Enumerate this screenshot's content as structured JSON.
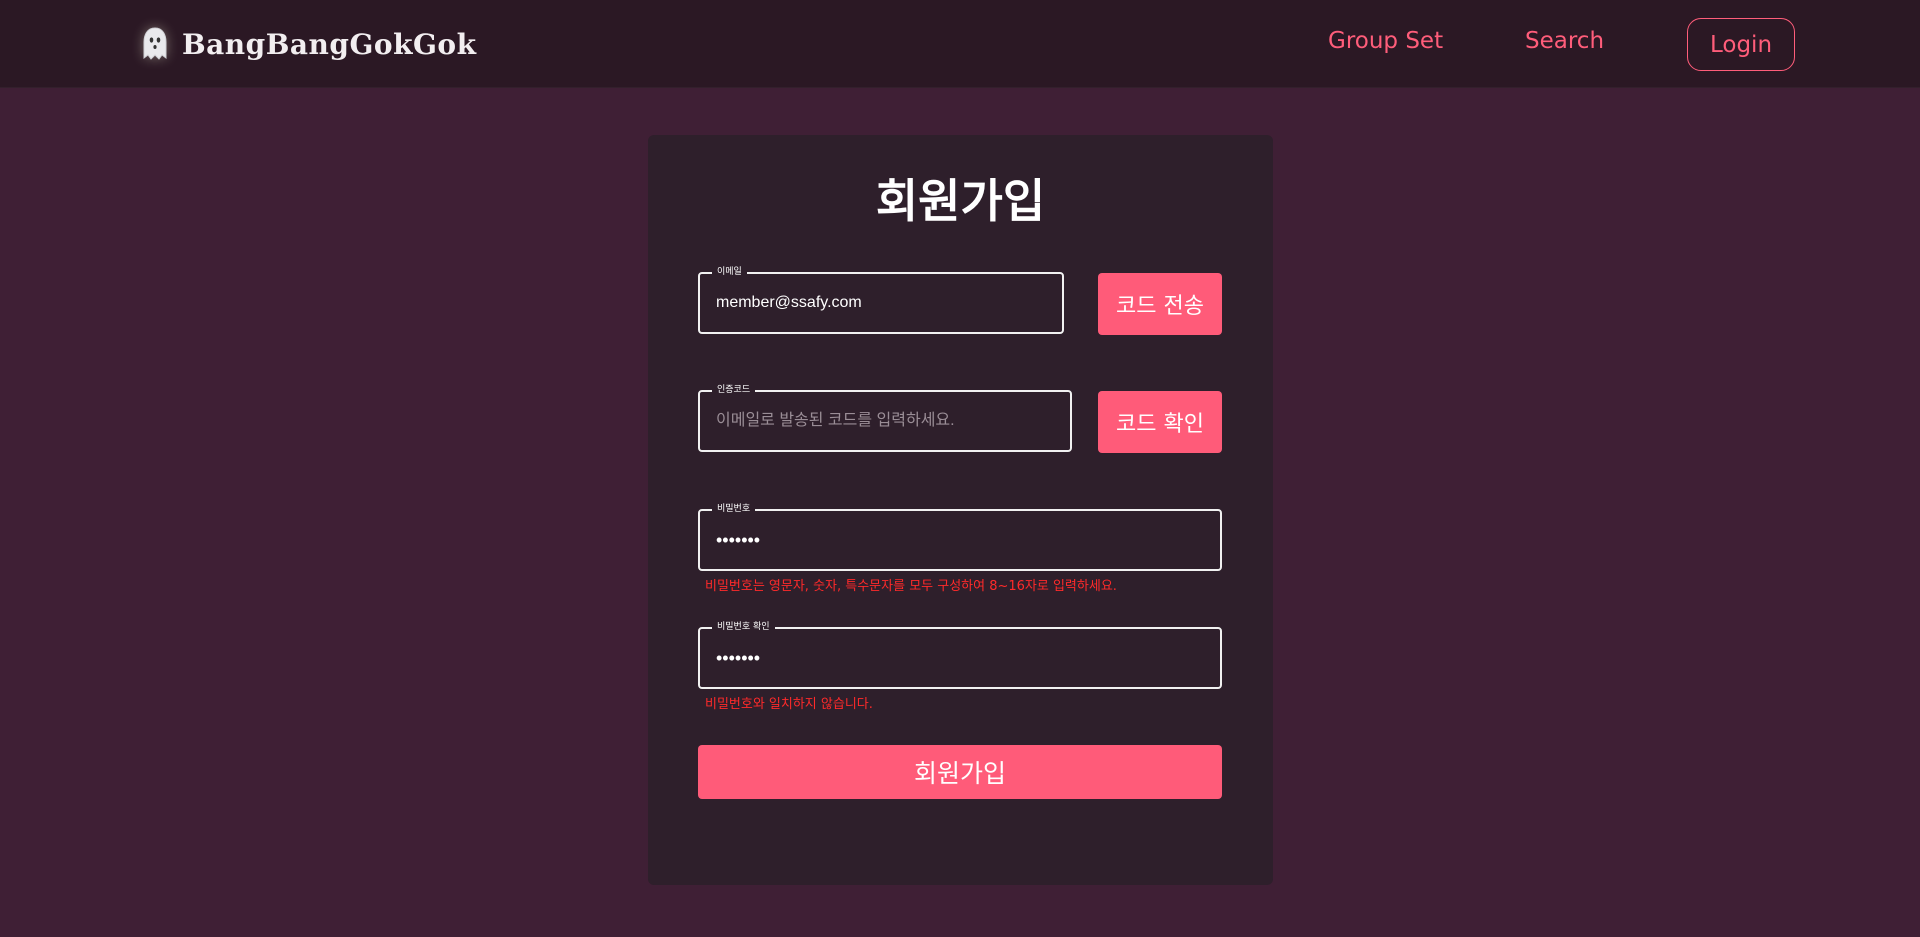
{
  "header": {
    "brand": "BangBangGokGok",
    "nav": [
      {
        "label": "Group Set"
      },
      {
        "label": "Search"
      }
    ],
    "login_label": "Login"
  },
  "signup": {
    "title": "회원가입",
    "email": {
      "label": "이메일",
      "value": "member@ssafy.com"
    },
    "send_code_label": "코드 전송",
    "code": {
      "label": "인증코드",
      "placeholder": "이메일로 발송된 코드를 입력하세요."
    },
    "verify_code_label": "코드 확인",
    "password": {
      "label": "비밀번호",
      "value": "•••••••",
      "error": "비밀번호는 영문자, 숫자, 특수문자를 모두 구성하여 8~16자로 입력하세요."
    },
    "password_confirm": {
      "label": "비밀번호 확인",
      "value": "•••••••",
      "error": "비밀번호와 일치하지 않습니다."
    },
    "submit_label": "회원가입"
  },
  "colors": {
    "accent": "#ff5b79",
    "background": "#3f1f35",
    "header": "#2b1824",
    "card": "#2e1f2b",
    "error": "#ff2a2a"
  },
  "icons": {
    "logo": "ghost-icon"
  }
}
